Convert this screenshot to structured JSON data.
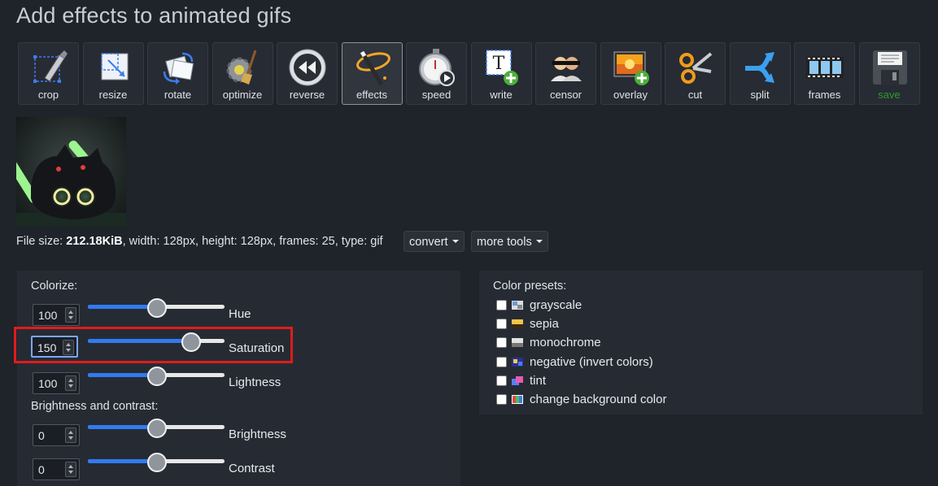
{
  "page": {
    "title": "Add effects to animated gifs"
  },
  "toolbar": {
    "items": [
      {
        "label": "crop",
        "icon": "crop-icon"
      },
      {
        "label": "resize",
        "icon": "resize-icon"
      },
      {
        "label": "rotate",
        "icon": "rotate-icon"
      },
      {
        "label": "optimize",
        "icon": "optimize-icon"
      },
      {
        "label": "reverse",
        "icon": "reverse-icon"
      },
      {
        "label": "effects",
        "icon": "magic-wand-icon",
        "active": true
      },
      {
        "label": "speed",
        "icon": "stopwatch-icon"
      },
      {
        "label": "write",
        "icon": "text-add-icon"
      },
      {
        "label": "censor",
        "icon": "censor-icon"
      },
      {
        "label": "overlay",
        "icon": "image-add-icon"
      },
      {
        "label": "cut",
        "icon": "scissors-icon"
      },
      {
        "label": "split",
        "icon": "split-icon"
      },
      {
        "label": "frames",
        "icon": "film-frames-icon"
      },
      {
        "label": "save",
        "icon": "floppy-disk-icon",
        "color": "#2e9a2e"
      }
    ]
  },
  "fileinfo": {
    "prefix": "File size: ",
    "size": "212.18KiB",
    "rest": ", width: 128px, height: 128px, frames: 25, type: gif"
  },
  "convert_label": "convert",
  "more_tools_label": "more tools",
  "colorize": {
    "heading": "Colorize:",
    "hue": {
      "value": "100",
      "label": "Hue",
      "fraction": 0.5
    },
    "saturation": {
      "value": "150",
      "label": "Saturation",
      "fraction": 0.75
    },
    "lightness": {
      "value": "100",
      "label": "Lightness",
      "fraction": 0.5
    }
  },
  "brightness_contrast": {
    "heading": "Brightness and contrast:",
    "brightness": {
      "value": "0",
      "label": "Brightness",
      "fraction": 0.5
    },
    "contrast": {
      "value": "0",
      "label": "Contrast",
      "fraction": 0.5
    }
  },
  "presets": {
    "heading": "Color presets:",
    "items": [
      {
        "label": "grayscale",
        "checked": false,
        "icon": "grayscale-icon"
      },
      {
        "label": "sepia",
        "checked": false,
        "icon": "sepia-icon"
      },
      {
        "label": "monochrome",
        "checked": false,
        "icon": "monochrome-icon"
      },
      {
        "label": "negative (invert colors)",
        "checked": false,
        "icon": "negative-icon"
      },
      {
        "label": "tint",
        "checked": false,
        "icon": "tint-icon"
      },
      {
        "label": "change background color",
        "checked": false,
        "icon": "background-color-icon"
      }
    ]
  },
  "colors": {
    "background": "#1f232a",
    "panel": "#262b33",
    "accent": "#2f7bf0",
    "highlight": "#e01b1b",
    "save": "#2e9a2e"
  }
}
